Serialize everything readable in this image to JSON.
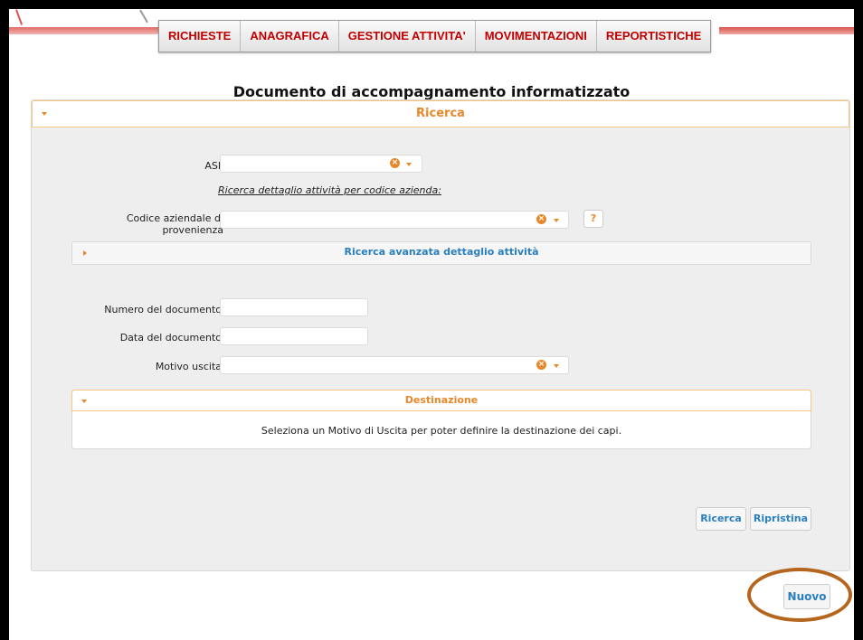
{
  "nav": {
    "items": [
      "RICHIESTE",
      "ANAGRAFICA",
      "GESTIONE ATTIVITA'",
      "MOVIMENTAZIONI",
      "REPORTISTICHE"
    ]
  },
  "page": {
    "title": "Documento di accompagnamento informatizzato"
  },
  "ricerca": {
    "title": "Ricerca",
    "asl_label": "ASL",
    "asl_value": "",
    "dettaglio_link": "Ricerca dettaglio attività per codice azienda:",
    "codice_label_line1": "Codice aziendale di",
    "codice_label_line2": "provenienza",
    "codice_value": "",
    "help_label": "?",
    "avanzata_title": "Ricerca avanzata dettaglio attività",
    "numero_label": "Numero del documento",
    "numero_value": "",
    "data_label": "Data del documento",
    "data_value": "",
    "motivo_label": "Motivo uscita",
    "motivo_value": "",
    "destinazione_title": "Destinazione",
    "destinazione_msg": "Seleziona un Motivo di Uscita per poter definire la destinazione dei capi.",
    "ricerca_button": "Ricerca",
    "ripristina_button": "Ripristina"
  },
  "footer": {
    "nuovo_button": "Nuovo"
  },
  "colors": {
    "accent": "#e8882a",
    "nav_text": "#c00000",
    "button_text": "#2a7fbf",
    "highlight_ring": "#b5651d"
  },
  "icons": [
    "clear-icon",
    "dropdown-caret-icon",
    "collapse-caret-icon",
    "expand-caret-icon",
    "help-icon"
  ]
}
